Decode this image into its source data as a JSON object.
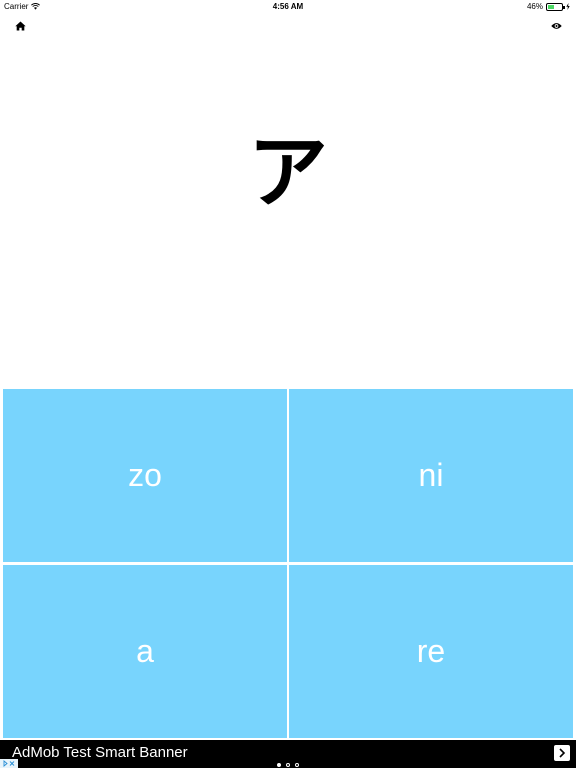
{
  "status_bar": {
    "carrier": "Carrier",
    "time": "4:56 AM",
    "battery_text": "46%",
    "battery_level": 0.46,
    "battery_color": "#4cd964"
  },
  "toolbar": {
    "home_icon": "home-icon",
    "eye_icon": "eye-icon"
  },
  "question": {
    "kana": "ア"
  },
  "answers": [
    {
      "label": "zo"
    },
    {
      "label": "ni"
    },
    {
      "label": "a"
    },
    {
      "label": "re"
    }
  ],
  "answer_color": "#78d4fd",
  "ad": {
    "text": "AdMob Test Smart Banner",
    "arrow_icon": "chevron-right-icon",
    "choices_icon": "adchoices-icon"
  },
  "pager": {
    "count": 3,
    "active_index": 0
  }
}
